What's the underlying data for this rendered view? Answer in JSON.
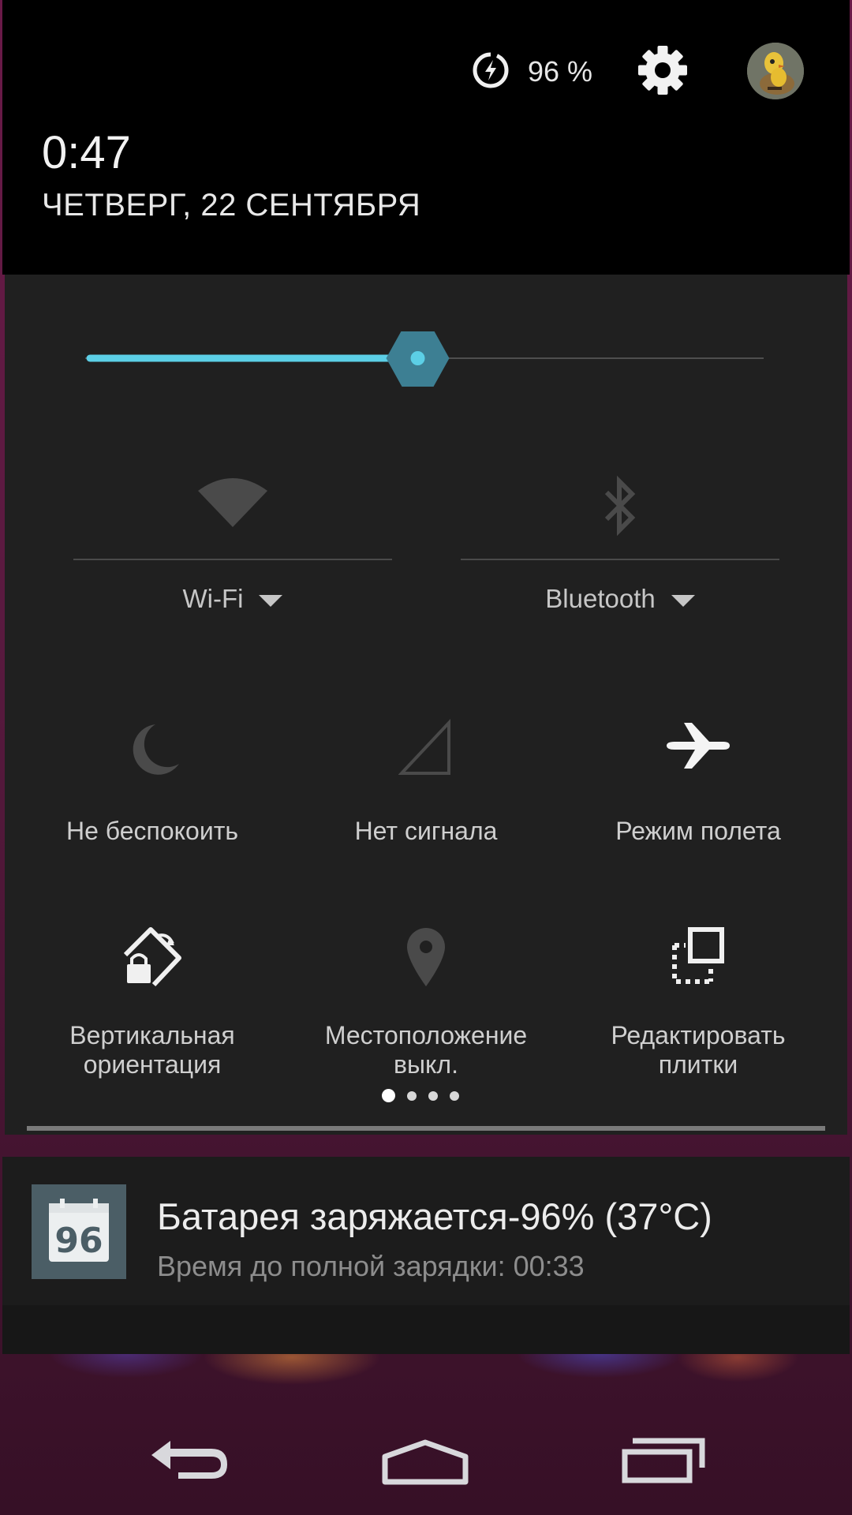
{
  "status_header": {
    "battery_icon": "battery-charging-icon",
    "battery_percent": "96 %",
    "settings_icon": "gear-icon",
    "avatar": "user-avatar",
    "time": "0:47",
    "date": "ЧЕТВЕРГ, 22 СЕНТЯБРЯ"
  },
  "brightness": {
    "level": 0.49,
    "accent_color": "#5ccfe6"
  },
  "big_tiles": [
    {
      "icon": "wifi-icon",
      "label": "Wi-Fi"
    },
    {
      "icon": "bluetooth-icon",
      "label": "Bluetooth"
    }
  ],
  "tiles": [
    {
      "icon": "moon-icon",
      "label": "Не беспокоить"
    },
    {
      "icon": "no-signal-icon",
      "label": "Нет сигнала"
    },
    {
      "icon": "airplane-icon",
      "label": "Режим полета"
    },
    {
      "icon": "rotation-lock-icon",
      "label_line1": "Вертикальная",
      "label_line2": "ориентация"
    },
    {
      "icon": "location-icon",
      "label_line1": "Местоположение",
      "label_line2": "выкл."
    },
    {
      "icon": "edit-tiles-icon",
      "label_line1": "Редактировать",
      "label_line2": "плитки"
    }
  ],
  "pager": {
    "pages": 4,
    "active": 1
  },
  "notification": {
    "icon_text": "96",
    "title": "Батарея заряжается-96% (37°C)",
    "subtitle": "Время до полной зарядки: 00:33"
  },
  "navbar": {
    "back_icon": "back-icon",
    "home_icon": "home-icon",
    "recents_icon": "recents-icon"
  }
}
